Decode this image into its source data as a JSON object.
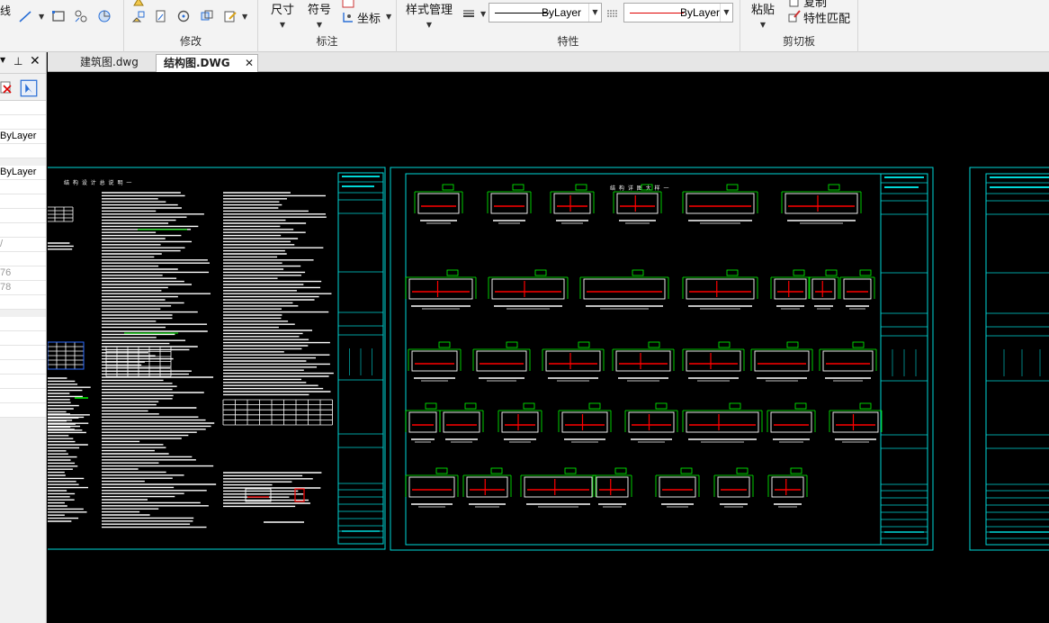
{
  "ribbon": {
    "draw_cut_label": "线",
    "groups": {
      "modify": "修改",
      "annotate": "标注",
      "properties": "特性",
      "clipboard": "剪切板"
    },
    "dimension_label": "尺寸",
    "symbol_label": "符号",
    "coordinate_label": "坐标",
    "style_manager_label": "样式管理",
    "paste_label": "粘贴",
    "match_props_label": "特性匹配",
    "copy_label": "复制",
    "linetype_value": "ByLayer",
    "color_value": "ByLayer",
    "color_swatch": "#e00000"
  },
  "left_panel": {
    "rows": [
      "",
      "",
      "ByLayer",
      "",
      "ByLayer",
      "",
      "",
      "",
      "",
      "/",
      "",
      "76",
      "78",
      "",
      "",
      "",
      "",
      "",
      "",
      "",
      ""
    ]
  },
  "tabs": [
    {
      "label": "建筑图.dwg",
      "active": false
    },
    {
      "label": "结构图.DWG",
      "active": true
    }
  ],
  "drawing": {
    "sheet1_title": "结 构 设 计 总 说 明 一",
    "sheet2_title": "结 构 详 图 大 样 一"
  },
  "colors": {
    "frame": "#00d7d7",
    "text_lines": "#ffffff",
    "green": "#00ff00",
    "red": "#ff0000"
  }
}
